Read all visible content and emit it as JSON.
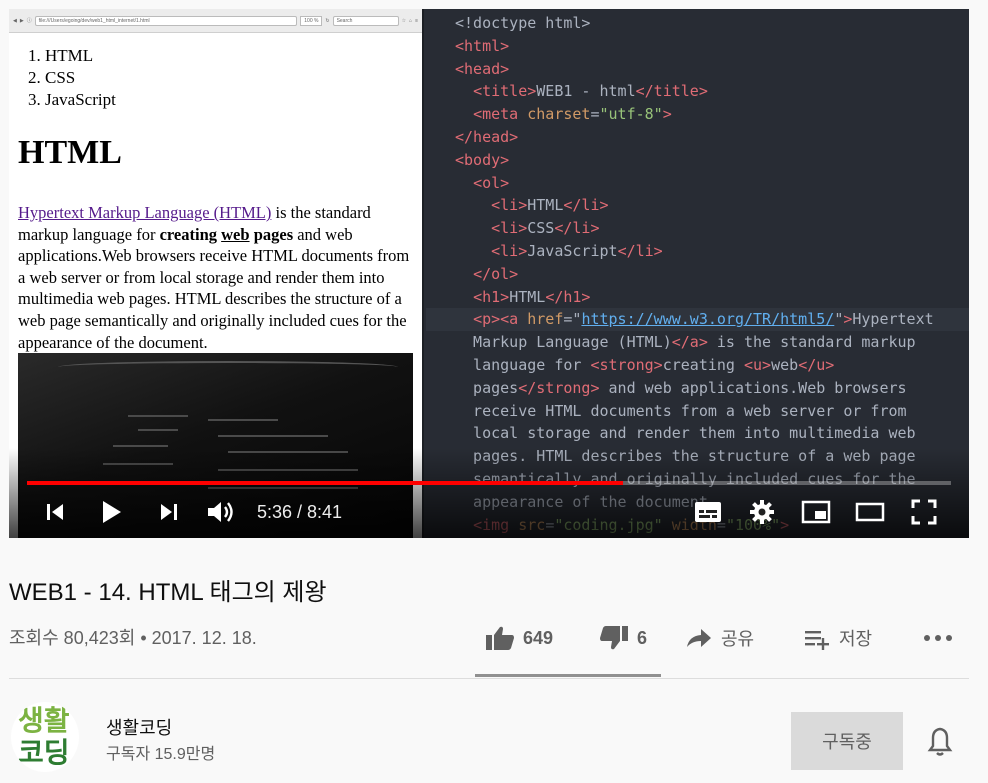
{
  "browser": {
    "url": "file:///Users/egoing/dev/web1_html_internet/1.html",
    "zoom": "100 %",
    "search_placeholder": "Search"
  },
  "page": {
    "list_items": [
      "HTML",
      "CSS",
      "JavaScript"
    ],
    "heading": "HTML",
    "link_text": "Hypertext Markup Language (HTML)",
    "para_1": " is the standard markup language for ",
    "strong_1": "creating ",
    "underline": "web",
    "strong_2": " pages",
    "para_2": " and web applications.Web browsers receive HTML documents from a web server or from local storage and render them into multimedia web pages. HTML describes the structure of a web page semantically and originally included cues for the appearance of the document."
  },
  "editor": {
    "lines": [
      [
        [
          "pl",
          "<!doctype html>"
        ]
      ],
      [
        [
          "tg",
          "<html>"
        ]
      ],
      [
        [
          "tg",
          "<head>"
        ]
      ],
      [
        [
          "pl",
          "  "
        ],
        [
          "tg",
          "<title>"
        ],
        [
          "pl",
          "WEB1 - html"
        ],
        [
          "tg",
          "</title>"
        ]
      ],
      [
        [
          "pl",
          "  "
        ],
        [
          "tg",
          "<meta "
        ],
        [
          "at",
          "charset"
        ],
        [
          "pl",
          "="
        ],
        [
          "sv",
          "\"utf-8\""
        ],
        [
          "tg",
          ">"
        ]
      ],
      [
        [
          "tg",
          "</head>"
        ]
      ],
      [
        [
          "tg",
          "<body>"
        ]
      ],
      [
        [
          "pl",
          "  "
        ],
        [
          "tg",
          "<ol>"
        ]
      ],
      [
        [
          "pl",
          "    "
        ],
        [
          "tg",
          "<li>"
        ],
        [
          "pl",
          "HTML"
        ],
        [
          "tg",
          "</li>"
        ]
      ],
      [
        [
          "pl",
          "    "
        ],
        [
          "tg",
          "<li>"
        ],
        [
          "pl",
          "CSS"
        ],
        [
          "tg",
          "</li>"
        ]
      ],
      [
        [
          "pl",
          "    "
        ],
        [
          "tg",
          "<li>"
        ],
        [
          "pl",
          "JavaScript"
        ],
        [
          "tg",
          "</li>"
        ]
      ],
      [
        [
          "pl",
          "  "
        ],
        [
          "tg",
          "</ol>"
        ]
      ],
      [
        [
          "pl",
          "  "
        ],
        [
          "tg",
          "<h1>"
        ],
        [
          "pl",
          "HTML"
        ],
        [
          "tg",
          "</h1>"
        ]
      ],
      [
        [
          "pl",
          "  "
        ],
        [
          "tg",
          "<p><a "
        ],
        [
          "at",
          "href"
        ],
        [
          "pl",
          "=\""
        ],
        [
          "ln-u",
          "https://www.w3.org/TR/html5/"
        ],
        [
          "pl",
          "\""
        ],
        [
          "tg",
          ">"
        ],
        [
          "pl",
          "Hypertext"
        ]
      ],
      [
        [
          "pl",
          "  Markup Language (HTML)"
        ],
        [
          "tg",
          "</a>"
        ],
        [
          "pl",
          " is the standard markup"
        ]
      ],
      [
        [
          "pl",
          "  language for "
        ],
        [
          "tg",
          "<strong>"
        ],
        [
          "pl",
          "creating "
        ],
        [
          "tg",
          "<u>"
        ],
        [
          "pl",
          "web"
        ],
        [
          "tg",
          "</u>"
        ]
      ],
      [
        [
          "pl",
          "  pages"
        ],
        [
          "tg",
          "</strong>"
        ],
        [
          "pl",
          " and web applications.Web browsers"
        ]
      ],
      [
        [
          "pl",
          "  receive HTML documents from a web server or from"
        ]
      ],
      [
        [
          "pl",
          "  local storage and render them into multimedia web"
        ]
      ],
      [
        [
          "pl",
          "  pages. HTML describes the structure of a web page"
        ]
      ],
      [
        [
          "pl",
          "  semantically and originally included cues for the"
        ]
      ],
      [
        [
          "pl",
          "  appearance of the document."
        ]
      ],
      [
        [
          "pl",
          "  "
        ],
        [
          "tg",
          "<img "
        ],
        [
          "at",
          "src"
        ],
        [
          "pl",
          "="
        ],
        [
          "sv",
          "\"coding.jpg\""
        ],
        [
          "at",
          " width"
        ],
        [
          "pl",
          "="
        ],
        [
          "sv",
          "\"100%\""
        ],
        [
          "tg",
          ">"
        ]
      ]
    ]
  },
  "player": {
    "time": "5:36 / 8:41",
    "progress": 0.645
  },
  "video": {
    "title": "WEB1 - 14. HTML 태그의 제왕",
    "views": "조회수 80,423회",
    "separator": "•",
    "date": "2017. 12. 18.",
    "likes": "649",
    "dislikes": "6",
    "share_label": "공유",
    "save_label": "저장"
  },
  "channel": {
    "avatar_text_1": "생활",
    "avatar_text_2": "코딩",
    "name": "생활코딩",
    "subscribers": "구독자 15.9만명",
    "subscribe_label": "구독중"
  }
}
